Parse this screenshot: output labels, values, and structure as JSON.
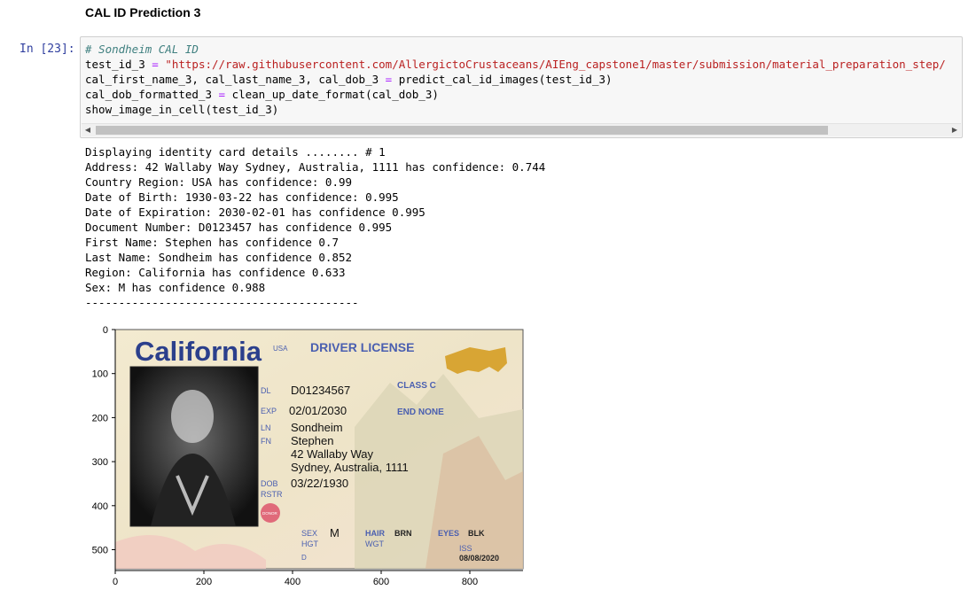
{
  "heading": "CAL ID Prediction 3",
  "cell": {
    "prompt": "In [23]:",
    "code_lines": [
      [
        {
          "t": "# Sondheim CAL ID",
          "c": "cm-comment"
        }
      ],
      [
        {
          "t": "test_id_3 "
        },
        {
          "t": "=",
          "c": "cm-op"
        },
        {
          "t": " "
        },
        {
          "t": "\"https://raw.githubusercontent.com/AllergictoCrustaceans/AIEng_capstone1/master/submission/material_preparation_step/",
          "c": "cm-str"
        }
      ],
      [
        {
          "t": "cal_first_name_3, cal_last_name_3, cal_dob_3 "
        },
        {
          "t": "=",
          "c": "cm-op"
        },
        {
          "t": " predict_cal_id_images(test_id_3)"
        }
      ],
      [
        {
          "t": "cal_dob_formatted_3 "
        },
        {
          "t": "=",
          "c": "cm-op"
        },
        {
          "t": " clean_up_date_format(cal_dob_3)"
        }
      ],
      [
        {
          "t": "show_image_in_cell(test_id_3)"
        }
      ]
    ]
  },
  "output_lines": [
    "Displaying identity card details ........ # 1",
    "Address: 42 Wallaby Way Sydney, Australia, 1111 has confidence: 0.744",
    "Country Region: USA has confidence: 0.99",
    "Date of Birth: 1930-03-22 has confidence: 0.995",
    "Date of Expiration: 2030-02-01 has confidence 0.995",
    "Document Number: D0123457 has confidence 0.995",
    "First Name: Stephen has confidence 0.7",
    "Last Name: Sondheim has confidence 0.852",
    "Region: California has confidence 0.633",
    "Sex: M has confidence 0.988",
    "-----------------------------------------"
  ],
  "image_plot": {
    "x_ticks": [
      "0",
      "200",
      "400",
      "600",
      "800"
    ],
    "y_ticks": [
      "0",
      "100",
      "200",
      "300",
      "400",
      "500"
    ],
    "card": {
      "state": "California",
      "usa": "USA",
      "title": "DRIVER LICENSE",
      "class": "CLASS C",
      "dl_label": "DL",
      "dl_value": "D01234567",
      "exp_label": "EXP",
      "exp_value": "02/01/2030",
      "end": "END NONE",
      "ln_label": "LN",
      "ln_value": "Sondheim",
      "fn_label": "FN",
      "fn_value": "Stephen",
      "addr1": "42 Wallaby Way",
      "addr2": "Sydney, Australia, 1111",
      "dob_label": "DOB",
      "dob_value": "03/22/1930",
      "rstr_label": "RSTR",
      "donor": "DONOR",
      "sex_label": "SEX",
      "sex_value": "M",
      "hgt_label": "HGT",
      "hair_label": "HAIR",
      "hair_value": "BRN",
      "wgt_label": "WGT",
      "eyes_label": "EYES",
      "eyes_value": "BLK",
      "iss_label": "ISS",
      "iss_value": "08/08/2020",
      "dd_label": "D"
    },
    "colors": {
      "title_blue": "#2b3f8c",
      "card_bg": "#efe7cf",
      "field_blue": "#4a5fb0"
    }
  }
}
